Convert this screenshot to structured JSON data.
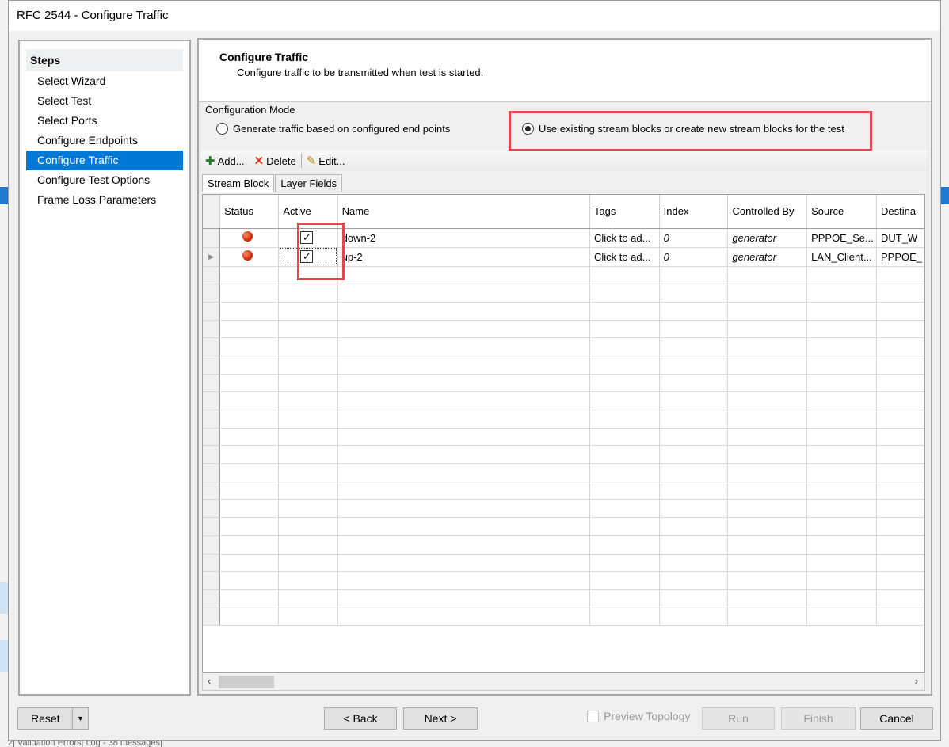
{
  "window": {
    "title": "RFC 2544 - Configure Traffic"
  },
  "steps": {
    "header": "Steps",
    "items": [
      {
        "label": "Select Wizard"
      },
      {
        "label": "Select Test"
      },
      {
        "label": "Select Ports"
      },
      {
        "label": "Configure Endpoints"
      },
      {
        "label": "Configure Traffic",
        "active": true
      },
      {
        "label": "Configure Test Options"
      },
      {
        "label": "Frame Loss Parameters"
      }
    ]
  },
  "header": {
    "title": "Configure Traffic",
    "description": "Configure traffic to be transmitted when test is started."
  },
  "config_mode": {
    "label": "Configuration Mode",
    "option_endpoints": "Generate traffic based on configured end points",
    "option_streams": "Use existing stream blocks or create new stream blocks for the test",
    "selected": "option_streams"
  },
  "toolbar": {
    "add": "Add...",
    "delete": "Delete",
    "edit": "Edit..."
  },
  "tabs": {
    "stream_block": "Stream Block",
    "layer_fields": "Layer Fields",
    "active": "stream_block"
  },
  "grid": {
    "columns": [
      "Status",
      "Active",
      "Name",
      "Tags",
      "Index",
      "Controlled By",
      "Source",
      "Destina"
    ],
    "rows": [
      {
        "status": "red",
        "active": true,
        "name": "down-2",
        "tags": "Click to ad...",
        "index": "0",
        "controlled_by": "generator",
        "source": "PPPOE_Se...",
        "destination": "DUT_W"
      },
      {
        "status": "red",
        "active": true,
        "name": "up-2",
        "tags": "Click to ad...",
        "index": "0",
        "controlled_by": "generator",
        "source": "LAN_Client...",
        "destination": "PPPOE_"
      }
    ]
  },
  "footer": {
    "reset": "Reset",
    "back": "< Back",
    "next": "Next >",
    "preview_topology": "Preview Topology",
    "run": "Run",
    "finish": "Finish",
    "cancel": "Cancel"
  },
  "status_bar": "2| Validation Errors| Log - 38 messages|",
  "colors": {
    "selection": "#0078d7",
    "highlight": "#e8434f",
    "status_dot": "#d42a00"
  }
}
